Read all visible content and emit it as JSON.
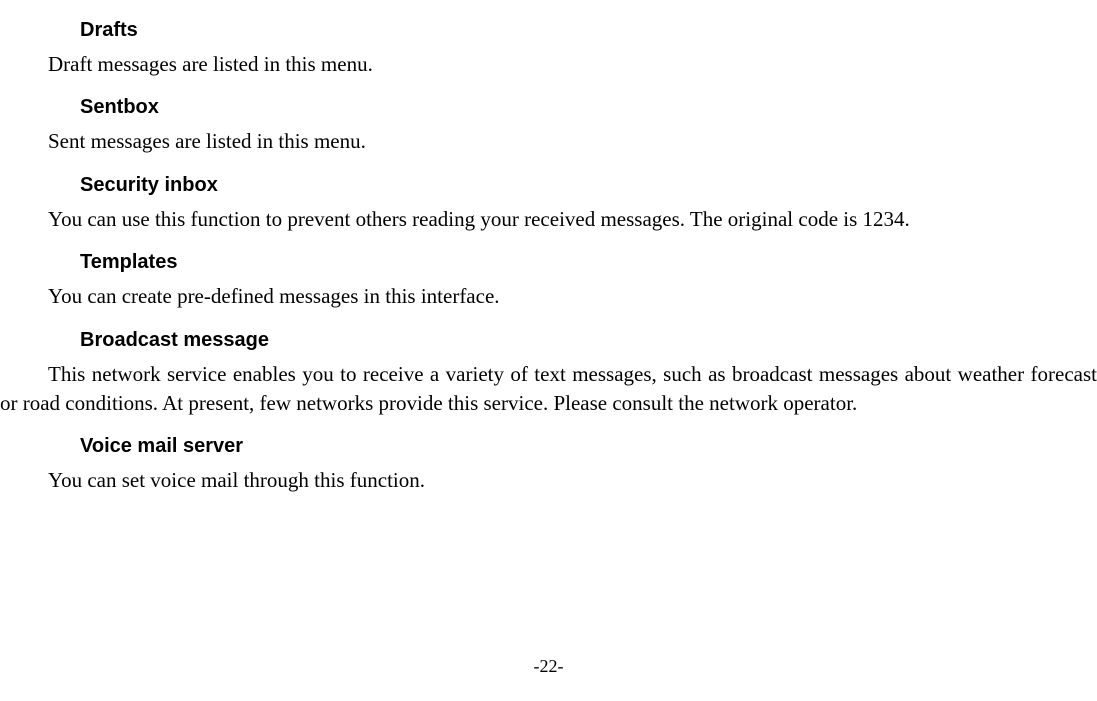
{
  "sections": {
    "drafts": {
      "heading": "Drafts",
      "body": "Draft messages are listed in this menu."
    },
    "sentbox": {
      "heading": "Sentbox",
      "body": "Sent messages are listed in this menu."
    },
    "security_inbox": {
      "heading": "Security inbox",
      "body": "You can use this function to prevent others reading your received messages. The original code is 1234."
    },
    "templates": {
      "heading": "Templates",
      "body": "You can create pre-defined messages in this interface."
    },
    "broadcast": {
      "heading": "Broadcast message",
      "body": "This network service enables you to receive a variety of text messages, such as broadcast messages about weather forecast or road conditions. At present, few networks provide this service. Please consult the network operator."
    },
    "voicemail": {
      "heading": "Voice mail server",
      "body": "You can set voice mail through this function."
    }
  },
  "page_number": "-22-"
}
